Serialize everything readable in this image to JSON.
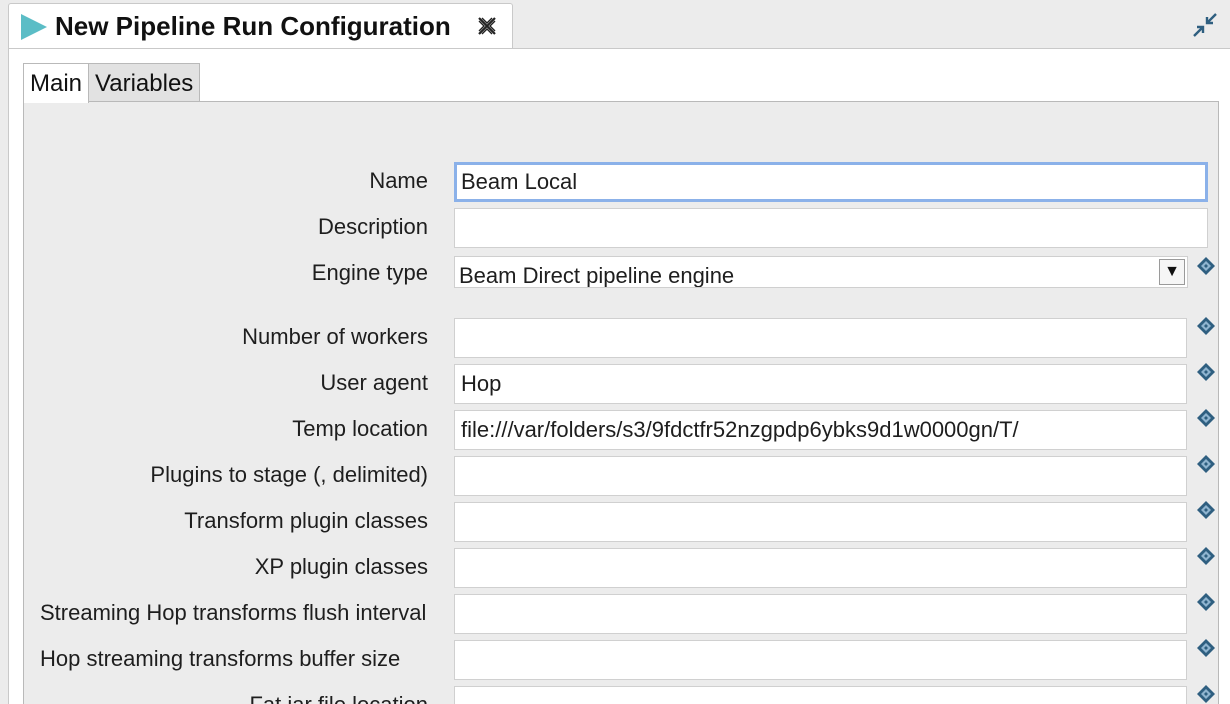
{
  "editor_tab": {
    "title": "New Pipeline Run Configuration"
  },
  "tabs": [
    {
      "label": "Main",
      "active": true
    },
    {
      "label": "Variables",
      "active": false
    }
  ],
  "form": {
    "name": {
      "label": "Name",
      "value": "Beam Local"
    },
    "description": {
      "label": "Description",
      "value": ""
    },
    "engine_type": {
      "label": "Engine type",
      "value": "Beam Direct pipeline engine"
    },
    "fields": [
      {
        "label": "Number of workers",
        "value": ""
      },
      {
        "label": "User agent",
        "value": "Hop"
      },
      {
        "label": "Temp location",
        "value": "file:///var/folders/s3/9fdctfr52nzgpdp6ybks9d1w0000gn/T/"
      },
      {
        "label": "Plugins to stage (, delimited)",
        "value": ""
      },
      {
        "label": "Transform plugin classes",
        "value": ""
      },
      {
        "label": "XP plugin classes",
        "value": ""
      },
      {
        "label": "Streaming Hop transforms flush interval",
        "value": ""
      },
      {
        "label": "Hop streaming transforms buffer size",
        "value": ""
      },
      {
        "label": "Fat jar file location",
        "value": ""
      }
    ]
  },
  "icons": {
    "run": "play-triangle-icon",
    "close": "close-x-icon",
    "minimize": "minimize-arrows-icon",
    "variable": "variable-diamond-icon"
  },
  "colors": {
    "run_icon": "#5bbdc6",
    "variable_icon": "#2f5f80",
    "focus_border": "#8bb1e9"
  }
}
